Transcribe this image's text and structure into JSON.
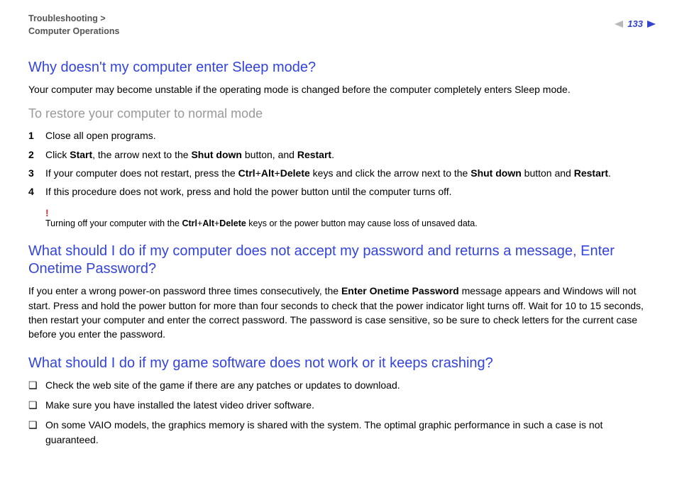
{
  "header": {
    "breadcrumb_line1": "Troubleshooting >",
    "breadcrumb_line2": "Computer Operations",
    "page_number": "133"
  },
  "section1": {
    "title": "Why doesn't my computer enter Sleep mode?",
    "intro": "Your computer may become unstable if the operating mode is changed before the computer completely enters Sleep mode.",
    "subhead": "To restore your computer to normal mode",
    "steps": [
      {
        "num": "1",
        "text": "Close all open programs."
      },
      {
        "num": "2",
        "pre": "Click ",
        "b1": "Start",
        "mid1": ", the arrow next to the ",
        "b2": "Shut down",
        "mid2": " button, and ",
        "b3": "Restart",
        "post": "."
      },
      {
        "num": "3",
        "pre": "If your computer does not restart, press the ",
        "b1": "Ctrl",
        "mid1": "+",
        "b2": "Alt",
        "mid2": "+",
        "b3": "Delete",
        "mid3": " keys and click the arrow next to the ",
        "b4": "Shut down",
        "mid4": " button and ",
        "b5": "Restart",
        "post": "."
      },
      {
        "num": "4",
        "text": "If this procedure does not work, press and hold the power button until the computer turns off."
      }
    ],
    "warn_mark": "!",
    "warn_pre": "Turning off your computer with the ",
    "warn_b1": "Ctrl",
    "warn_p1": "+",
    "warn_b2": "Alt",
    "warn_p2": "+",
    "warn_b3": "Delete",
    "warn_post": " keys or the power button may cause loss of unsaved data."
  },
  "section2": {
    "title": "What should I do if my computer does not accept my password and returns a message, Enter Onetime Password?",
    "para_pre": "If you enter a wrong power-on password three times consecutively, the ",
    "para_b": "Enter Onetime Password",
    "para_post": " message appears and Windows will not start. Press and hold the power button for more than four seconds to check that the power indicator light turns off. Wait for 10 to 15 seconds, then restart your computer and enter the correct password. The password is case sensitive, so be sure to check letters for the current case before you enter the password."
  },
  "section3": {
    "title": "What should I do if my game software does not work or it keeps crashing?",
    "bullets": [
      "Check the web site of the game if there are any patches or updates to download.",
      "Make sure you have installed the latest video driver software.",
      "On some VAIO models, the graphics memory is shared with the system. The optimal graphic performance in such a case is not guaranteed."
    ]
  }
}
